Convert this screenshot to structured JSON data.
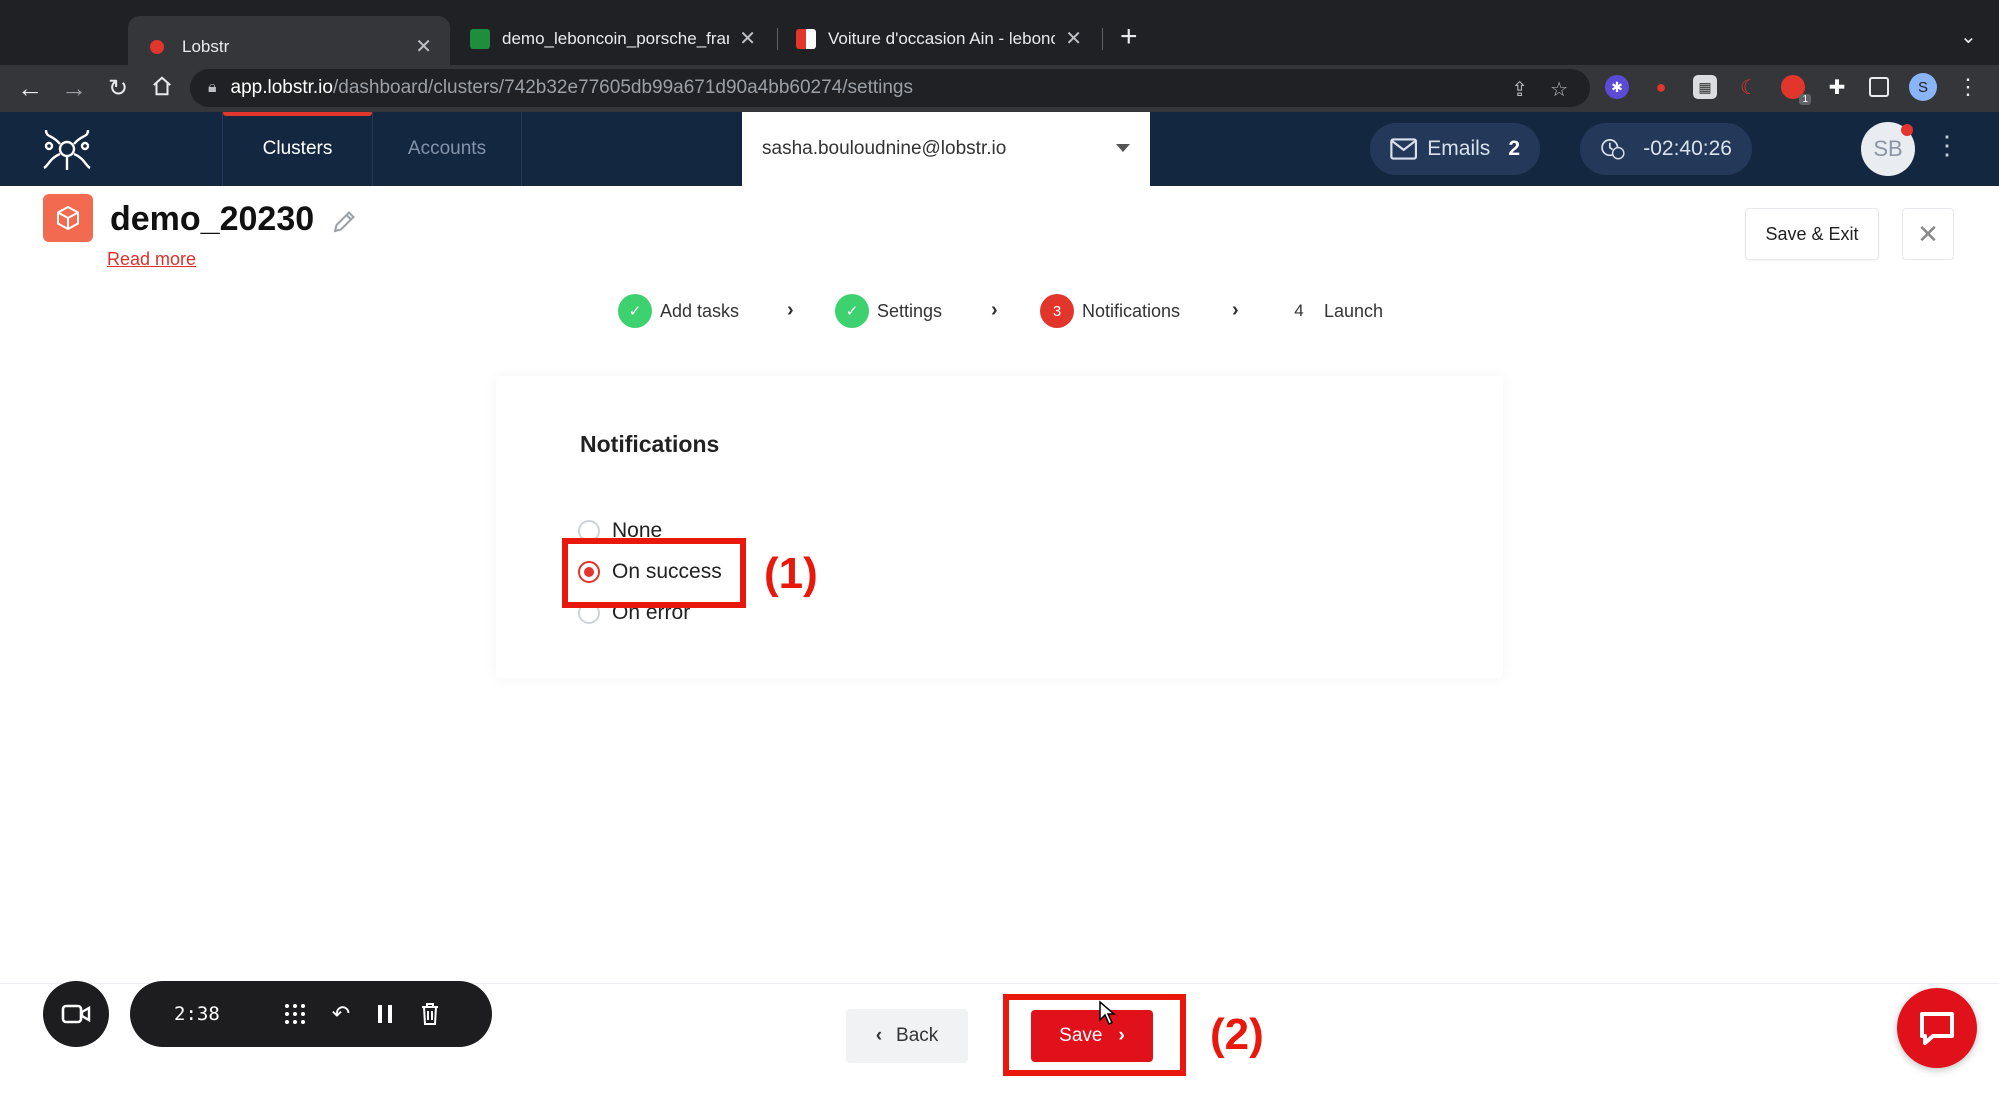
{
  "browser": {
    "tabs": [
      {
        "title": "Lobstr",
        "active": true,
        "favicon_color": "#e2352b"
      },
      {
        "title": "demo_leboncoin_porsche_fran",
        "active": false,
        "favicon_color": "#1e8e3e"
      },
      {
        "title": "Voiture d'occasion Ain - leboncoin",
        "active": false,
        "favicon_color": "#f56b2a"
      }
    ],
    "url_host": "app.lobstr.io",
    "url_path": "/dashboard/clusters/742b32e77605db99a671d90a4bb60274/settings",
    "profile_initial": "S",
    "extension_badge": "1"
  },
  "app": {
    "nav": {
      "clusters": "Clusters",
      "accounts": "Accounts"
    },
    "account_email": "sasha.bouloudnine@lobstr.io",
    "emails_label": "Emails",
    "emails_count": "2",
    "credit_timer": "-02:40:26",
    "avatar_initials": "SB"
  },
  "page": {
    "project_name": "demo_20230​",
    "read_more": "Read more",
    "save_exit": "Save & Exit",
    "steps": [
      {
        "label": "Add tasks",
        "state": "done"
      },
      {
        "label": "Settings",
        "state": "done"
      },
      {
        "label": "Notifications",
        "state": "current",
        "number": "3"
      },
      {
        "label": "Launch",
        "state": "todo",
        "number": "4"
      }
    ],
    "card_title": "Notifications",
    "options": [
      {
        "label": "None",
        "checked": false
      },
      {
        "label": "On success",
        "checked": true
      },
      {
        "label": "On error",
        "checked": false
      }
    ],
    "back_label": "Back",
    "save_label": "Save"
  },
  "annotations": {
    "label_1": "(1)",
    "label_2": "(2)"
  },
  "recorder": {
    "time": "2:38"
  },
  "colors": {
    "brand_red": "#e2352b",
    "header_navy": "#142741",
    "success_green": "#3ed170",
    "annotation_red": "#e9180c"
  }
}
